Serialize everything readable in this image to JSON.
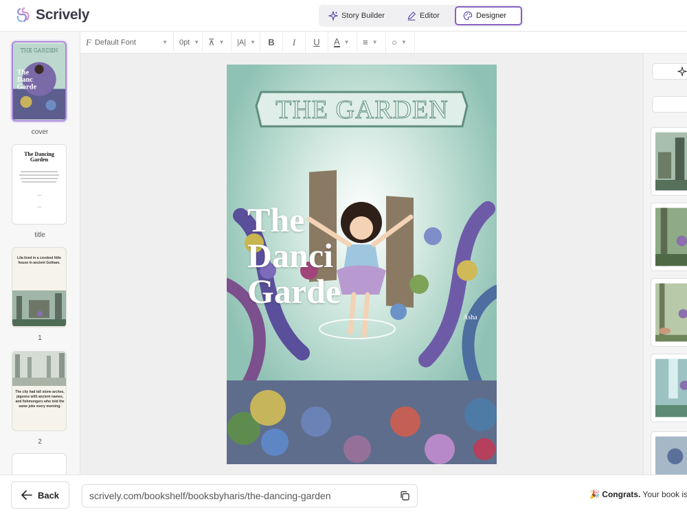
{
  "app": {
    "name": "Scrively"
  },
  "modes": [
    {
      "label": "Story Builder",
      "icon": "sparkle-icon",
      "active": false
    },
    {
      "label": "Editor",
      "icon": "pen-icon",
      "active": false
    },
    {
      "label": "Designer",
      "icon": "palette-icon",
      "active": true
    }
  ],
  "toolbar": {
    "font": "Default Font",
    "size": "0pt",
    "bold": "B",
    "italic": "I",
    "underline": "U",
    "text_color": "A"
  },
  "pages": [
    {
      "label": "cover",
      "selected": true
    },
    {
      "label": "title",
      "selected": false
    },
    {
      "label": "1",
      "selected": false
    },
    {
      "label": "2",
      "selected": false
    }
  ],
  "title_page": {
    "title": "The Dancing Garden"
  },
  "page1": {
    "text": "Lila lived in a crooked little house in ancient Gotham."
  },
  "page2": {
    "text": "The city had tall stone arches, pigeons with ancient names, and fishmongers who told the same joke every morning."
  },
  "cover": {
    "banner": "THE GARDEN",
    "title_line1": "The",
    "title_line2": "Danci",
    "title_line3": "Garde",
    "author": "Asha"
  },
  "footer": {
    "back_label": "Back",
    "url": "scrively.com/bookshelf/booksbyharis/the-dancing-garden",
    "congrats_emoji": "🎉",
    "congrats_bold": "Congrats.",
    "congrats_text": " Your book is"
  },
  "colors": {
    "accent": "#8661c1",
    "border": "#e4e4e4"
  }
}
